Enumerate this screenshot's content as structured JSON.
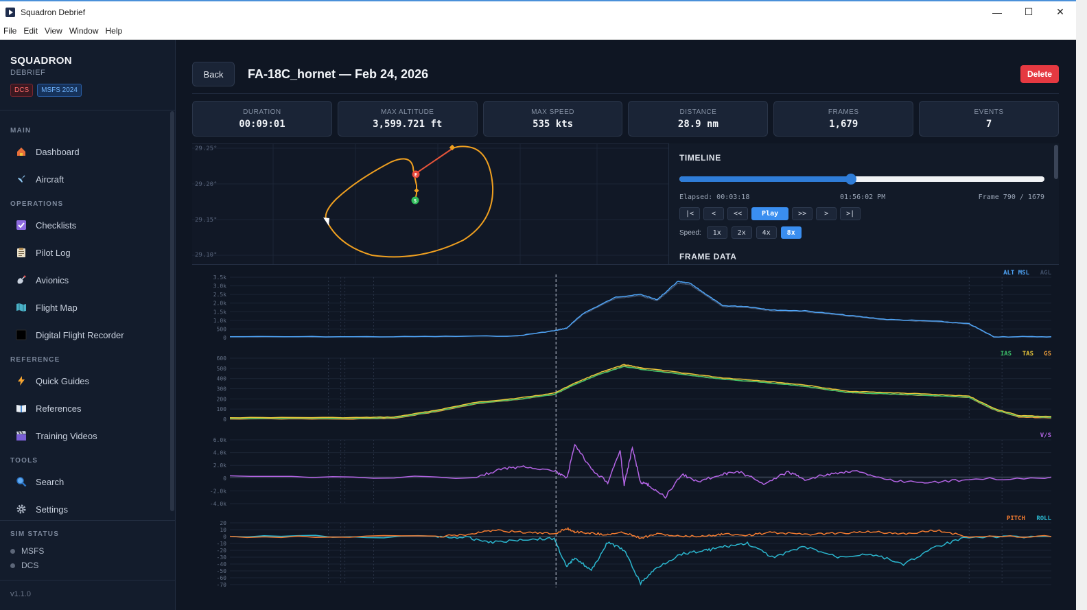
{
  "window": {
    "title": "Squadron Debrief",
    "controls": [
      "—",
      "☐",
      "✕"
    ]
  },
  "menu": [
    "File",
    "Edit",
    "View",
    "Window",
    "Help"
  ],
  "brand": {
    "name": "SQUADRON",
    "sub": "DEBRIEF",
    "badges": [
      "DCS",
      "MSFS 2024"
    ]
  },
  "nav": {
    "sections": [
      {
        "title": "MAIN",
        "items": [
          {
            "label": "Dashboard",
            "icon": "house-icon"
          },
          {
            "label": "Aircraft",
            "icon": "airplane-icon"
          }
        ]
      },
      {
        "title": "OPERATIONS",
        "items": [
          {
            "label": "Checklists",
            "icon": "checkbox-icon"
          },
          {
            "label": "Pilot Log",
            "icon": "clipboard-icon"
          },
          {
            "label": "Avionics",
            "icon": "satellite-icon"
          },
          {
            "label": "Flight Map",
            "icon": "map-icon"
          },
          {
            "label": "Digital Flight Recorder",
            "icon": "recorder-icon"
          }
        ]
      },
      {
        "title": "REFERENCE",
        "items": [
          {
            "label": "Quick Guides",
            "icon": "lightning-icon"
          },
          {
            "label": "References",
            "icon": "book-icon"
          },
          {
            "label": "Training Videos",
            "icon": "clapper-icon"
          }
        ]
      },
      {
        "title": "TOOLS",
        "items": [
          {
            "label": "Search",
            "icon": "magnifier-icon"
          },
          {
            "label": "Settings",
            "icon": "gear-icon"
          }
        ]
      }
    ]
  },
  "sim_status": {
    "title": "SIM STATUS",
    "items": [
      "MSFS",
      "DCS"
    ]
  },
  "version": "v1.1.0",
  "header": {
    "back_label": "Back",
    "title": "FA-18C_hornet — Feb 24, 2026",
    "delete_label": "Delete"
  },
  "stats": [
    {
      "label": "DURATION",
      "value": "00:09:01"
    },
    {
      "label": "MAX ALTITUDE",
      "value": "3,599.721 ft"
    },
    {
      "label": "MAX SPEED",
      "value": "535 kts"
    },
    {
      "label": "DISTANCE",
      "value": "28.9 nm"
    },
    {
      "label": "FRAMES",
      "value": "1,679"
    },
    {
      "label": "EVENTS",
      "value": "7"
    }
  ],
  "map": {
    "lat_labels": [
      "29.25°",
      "29.20°",
      "29.15°",
      "29.10°"
    ],
    "start_marker": "S",
    "end_marker": "E",
    "colors": {
      "track": "#f0a020",
      "track_end": "#e8553a"
    }
  },
  "timeline": {
    "title": "TIMELINE",
    "elapsed": "Elapsed: 00:03:18",
    "clock": "01:56:02 PM",
    "frame": "Frame 790 / 1679",
    "progress": 0.47,
    "controls": [
      "|<",
      "<",
      "<<",
      "Play",
      ">>",
      ">",
      ">|"
    ],
    "speed_label": "Speed:",
    "speeds": [
      "1x",
      "2x",
      "4x",
      "8x"
    ],
    "active_speed": "8x",
    "frame_data_title": "FRAME DATA"
  },
  "chart_data": [
    {
      "type": "line",
      "series": [
        {
          "name": "ALT MSL",
          "color": "#4ea3f5"
        },
        {
          "name": "AGL",
          "color": "#3e4d66"
        }
      ],
      "y_ticks": [
        "3.5k",
        "3.0k",
        "2.5k",
        "2.0k",
        "1.5k",
        "1.0k",
        "500",
        "0"
      ],
      "ylim": [
        0,
        3500
      ],
      "x": [
        0,
        0.2,
        0.35,
        0.395,
        0.41,
        0.43,
        0.47,
        0.5,
        0.52,
        0.53,
        0.545,
        0.56,
        0.58,
        0.6,
        0.63,
        0.66,
        0.7,
        0.75,
        0.8,
        0.86,
        0.9,
        0.93,
        1
      ],
      "values": [
        50,
        50,
        100,
        400,
        550,
        1400,
        2350,
        2500,
        2200,
        2600,
        3250,
        3150,
        2500,
        1850,
        1800,
        1600,
        1550,
        1300,
        1050,
        950,
        800,
        50,
        50
      ]
    },
    {
      "type": "line",
      "series": [
        {
          "name": "IAS",
          "color": "#3cc06a"
        },
        {
          "name": "TAS",
          "color": "#e8c63a"
        },
        {
          "name": "GS",
          "color": "#e89a3a"
        }
      ],
      "y_ticks": [
        "600",
        "500",
        "400",
        "300",
        "200",
        "100",
        "0"
      ],
      "ylim": [
        0,
        600
      ],
      "x": [
        0,
        0.15,
        0.2,
        0.25,
        0.3,
        0.35,
        0.395,
        0.42,
        0.45,
        0.48,
        0.5,
        0.55,
        0.6,
        0.65,
        0.7,
        0.75,
        0.8,
        0.85,
        0.9,
        0.93,
        0.96,
        1
      ],
      "values": [
        10,
        10,
        15,
        80,
        160,
        200,
        250,
        350,
        450,
        530,
        500,
        450,
        400,
        370,
        330,
        270,
        255,
        240,
        220,
        100,
        30,
        20
      ]
    },
    {
      "type": "line",
      "series": [
        {
          "name": "V/S",
          "color": "#b565e6"
        }
      ],
      "y_ticks": [
        "6.0k",
        "4.0k",
        "2.0k",
        "0",
        "-2.0k",
        "-4.0k"
      ],
      "ylim": [
        -5000,
        7000
      ],
      "x": [
        0,
        0.3,
        0.33,
        0.36,
        0.395,
        0.41,
        0.42,
        0.44,
        0.46,
        0.475,
        0.48,
        0.49,
        0.5,
        0.51,
        0.53,
        0.55,
        0.57,
        0.6,
        0.62,
        0.65,
        0.68,
        0.7,
        0.73,
        0.76,
        0.8,
        0.85,
        0.9,
        1
      ],
      "values": [
        0,
        0,
        1500,
        2000,
        1200,
        -300,
        6000,
        1500,
        -1000,
        5000,
        -1500,
        5500,
        -1000,
        -1500,
        -3800,
        500,
        -800,
        500,
        1000,
        -1200,
        1000,
        -500,
        600,
        1200,
        -600,
        -1000,
        -500,
        0
      ]
    },
    {
      "type": "line",
      "series": [
        {
          "name": "PITCH",
          "color": "#f07a30"
        },
        {
          "name": "ROLL",
          "color": "#2bb7cf"
        }
      ],
      "y_ticks": [
        "20",
        "10",
        "0",
        "-10",
        "-20",
        "-30",
        "-40",
        "-50",
        "-60",
        "-70"
      ],
      "ylim": [
        -70,
        20
      ],
      "x": [
        0,
        0.25,
        0.29,
        0.32,
        0.36,
        0.395,
        0.41,
        0.42,
        0.44,
        0.46,
        0.48,
        0.5,
        0.52,
        0.55,
        0.58,
        0.6,
        0.63,
        0.66,
        0.7,
        0.74,
        0.78,
        0.82,
        0.86,
        0.9,
        1
      ],
      "pitch": [
        0,
        0,
        3,
        9,
        6,
        4,
        12,
        7,
        5,
        3,
        6,
        -2,
        4,
        0,
        1,
        4,
        2,
        6,
        3,
        5,
        7,
        4,
        9,
        0,
        0
      ],
      "roll": [
        0,
        0,
        -2,
        -8,
        -4,
        -3,
        -45,
        -30,
        -50,
        -8,
        -20,
        -68,
        -45,
        -25,
        -20,
        -15,
        -10,
        -30,
        -15,
        -30,
        -25,
        -40,
        -15,
        0,
        0
      ]
    }
  ]
}
